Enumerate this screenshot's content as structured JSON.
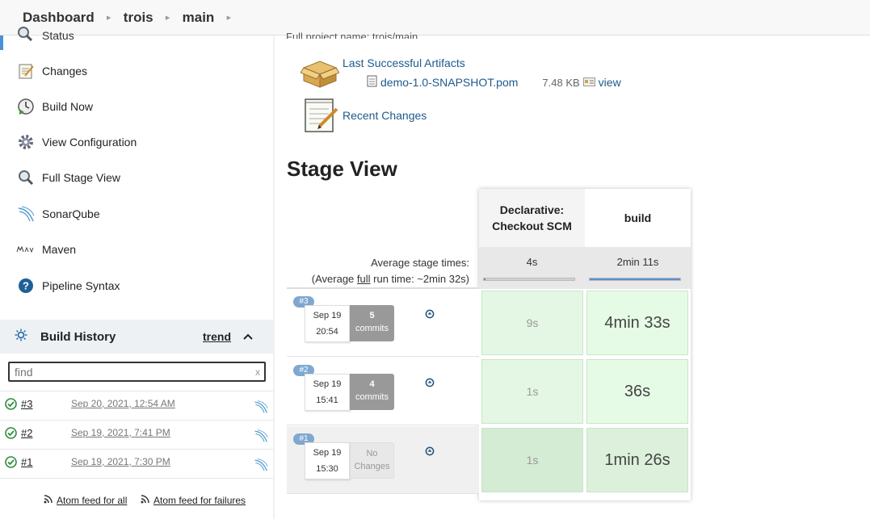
{
  "breadcrumb": [
    "Dashboard",
    "trois",
    "main"
  ],
  "sidebar": {
    "status_label": "Status",
    "tasks": [
      {
        "label": "Changes",
        "icon": "notepad-icon"
      },
      {
        "label": "Build Now",
        "icon": "clock-icon"
      },
      {
        "label": "View Configuration",
        "icon": "gear-icon"
      },
      {
        "label": "Full Stage View",
        "icon": "magnifier-icon"
      },
      {
        "label": "SonarQube",
        "icon": "sonarqube-icon"
      },
      {
        "label": "Maven",
        "icon": "maven-icon"
      },
      {
        "label": "Pipeline Syntax",
        "icon": "help-icon"
      }
    ],
    "build_history": {
      "title": "Build History",
      "trend": "trend",
      "find_placeholder": "find",
      "find_clear": "x",
      "builds": [
        {
          "num": "#3",
          "date": "Sep 20, 2021, 12:54 AM"
        },
        {
          "num": "#2",
          "date": "Sep 19, 2021, 7:41 PM"
        },
        {
          "num": "#1",
          "date": "Sep 19, 2021, 7:30 PM"
        }
      ],
      "feed_all": "Atom feed for all",
      "feed_failures": "Atom feed for failures"
    }
  },
  "main": {
    "partial_text": "Full project name: trois/main",
    "artifacts_title": "Last Successful Artifacts",
    "artifact": {
      "name": "demo-1.0-SNAPSHOT.pom",
      "size": "7.48 KB",
      "view": "view"
    },
    "recent_changes": "Recent Changes",
    "stage_view_title": "Stage View",
    "stage_view": {
      "stages": [
        "Declarative: Checkout SCM",
        "build"
      ],
      "avg_label": "Average stage times:",
      "avg_run_prefix": "(Average ",
      "avg_run_link": "full",
      "avg_run_suffix": " run time: ~2min 32s)",
      "avg_times": [
        "4s",
        "2min 11s"
      ],
      "avg_fill": [
        0.02,
        1.0
      ],
      "runs": [
        {
          "badge": "#3",
          "date": "Sep 19",
          "time": "20:54",
          "commits_num": "5",
          "commits_word": "commits",
          "durations": [
            "9s",
            "4min 33s"
          ]
        },
        {
          "badge": "#2",
          "date": "Sep 19",
          "time": "15:41",
          "commits_num": "4",
          "commits_word": "commits",
          "durations": [
            "1s",
            "36s"
          ]
        },
        {
          "badge": "#1",
          "date": "Sep 19",
          "time": "15:30",
          "commits_num": "No",
          "commits_word": "Changes",
          "durations": [
            "1s",
            "1min 26s"
          ]
        }
      ]
    }
  },
  "colors": {
    "link": "#1e5a8c",
    "success_cell": "#e6fbe6",
    "avg_bar": "#5b8fd1"
  }
}
